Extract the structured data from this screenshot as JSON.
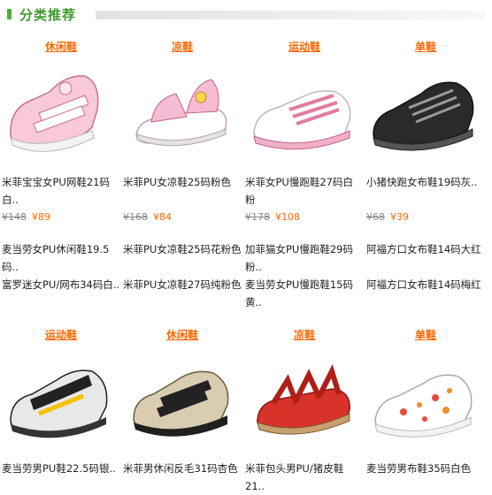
{
  "section": {
    "title": "分类推荐"
  },
  "row1": [
    {
      "category": "休闲鞋",
      "name": "米菲宝宝女PU网鞋21码白..",
      "old_price": "¥148",
      "new_price": "¥89",
      "links": [
        "麦当劳女PU休闲鞋19.5码..",
        "富罗迷女PU/网布34码白.."
      ]
    },
    {
      "category": "凉鞋",
      "name": "米菲PU女凉鞋25码粉色",
      "old_price": "¥168",
      "new_price": "¥84",
      "links": [
        "米菲PU女凉鞋25码花粉色",
        "米菲PU女凉鞋27码纯粉色"
      ]
    },
    {
      "category": "运动鞋",
      "name": "米菲女PU慢跑鞋27码白粉",
      "old_price": "¥178",
      "new_price": "¥108",
      "links": [
        "加菲猫女PU慢跑鞋29码粉..",
        "麦当劳女PU慢跑鞋15码黄.."
      ]
    },
    {
      "category": "单鞋",
      "name": "小猪快跑女布鞋19码灰..",
      "old_price": "¥68",
      "new_price": "¥39",
      "links": [
        "阿福方口女布鞋14码大红",
        "阿福方口女布鞋14码梅红"
      ]
    }
  ],
  "row2": [
    {
      "category": "运动鞋",
      "name": "麦当劳男PU鞋22.5码银.."
    },
    {
      "category": "休闲鞋",
      "name": "米菲男休闲反毛31码杏色"
    },
    {
      "category": "凉鞋",
      "name": "米菲包头男PU/猪皮鞋21.."
    },
    {
      "category": "单鞋",
      "name": "麦当劳男布鞋35码白色"
    }
  ],
  "colors": {
    "accent": "#ff6600",
    "title_green": "#3e9a2e"
  },
  "icons": [
    "shoe-photo-pink-velcro-sneaker",
    "shoe-photo-pink-sandal",
    "shoe-photo-white-pink-sneaker",
    "shoe-photo-black-sneaker",
    "shoe-photo-black-yellow-sneaker",
    "shoe-photo-black-beige-shoe",
    "shoe-photo-red-sandal",
    "shoe-photo-white-canvas-shoe"
  ]
}
